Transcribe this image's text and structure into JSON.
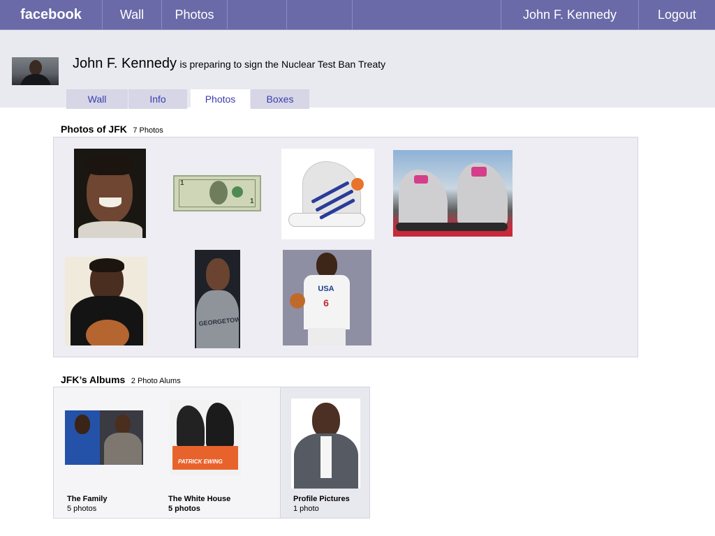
{
  "nav": {
    "brand": "facebook",
    "items": [
      "Wall",
      "Photos",
      "",
      ""
    ],
    "user": "John F. Kennedy",
    "logout": "Logout"
  },
  "profile": {
    "name": "John F. Kennedy",
    "status": "is preparing to sign the Nuclear Test Ban Treaty"
  },
  "tabs": [
    {
      "label": "Wall"
    },
    {
      "label": "Info"
    },
    {
      "label": "Photos",
      "active": true
    },
    {
      "label": "Boxes"
    }
  ],
  "photos_section": {
    "title": "Photos of JFK",
    "count": "7 Photos",
    "items": [
      {
        "icon": "portrait-photo"
      },
      {
        "icon": "dollar-bill-photo"
      },
      {
        "icon": "sneaker-photo"
      },
      {
        "icon": "sneakers-outdoor-photo"
      },
      {
        "icon": "basketball-portrait-photo"
      },
      {
        "icon": "georgetown-hoodie-photo"
      },
      {
        "icon": "usa-jersey-photo"
      }
    ]
  },
  "albums_section": {
    "title": "JFK’s Albums",
    "count": "2 Photo Alums",
    "albums": [
      {
        "name": "The Family",
        "count": "5 photos"
      },
      {
        "name": "The White House",
        "count": "5 photos"
      },
      {
        "name": "Profile Pictures",
        "count": "1 photo"
      }
    ]
  },
  "colors": {
    "nav_bg": "#6a6aa8",
    "header_bg": "#e9e9f0",
    "tab_text": "#3b3bb0"
  }
}
